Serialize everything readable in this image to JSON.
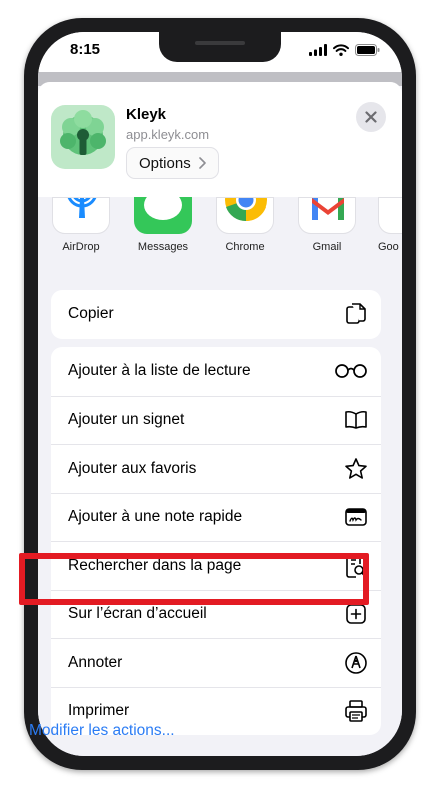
{
  "status_bar": {
    "time": "8:15"
  },
  "app": {
    "name": "Kleyk",
    "url": "app.kleyk.com",
    "options_label": "Options"
  },
  "share_targets": [
    {
      "label": "AirDrop",
      "icon": "airdrop-icon"
    },
    {
      "label": "Messages",
      "icon": "messages-icon"
    },
    {
      "label": "Chrome",
      "icon": "chrome-icon"
    },
    {
      "label": "Gmail",
      "icon": "gmail-icon"
    },
    {
      "label": "Goo",
      "icon": "google-icon"
    }
  ],
  "actions_group_1": [
    {
      "label": "Copier",
      "icon": "copy-icon"
    }
  ],
  "actions_group_2": [
    {
      "label": "Ajouter à la liste de lecture",
      "icon": "glasses-icon"
    },
    {
      "label": "Ajouter un signet",
      "icon": "book-icon"
    },
    {
      "label": "Ajouter aux favoris",
      "icon": "star-icon"
    },
    {
      "label": "Ajouter à une note rapide",
      "icon": "quick-note-icon"
    },
    {
      "label": "Rechercher dans la page",
      "icon": "find-in-page-icon"
    },
    {
      "label": "Sur l’écran d’accueil",
      "icon": "add-square-icon"
    },
    {
      "label": "Annoter",
      "icon": "markup-icon"
    },
    {
      "label": "Imprimer",
      "icon": "printer-icon"
    }
  ],
  "edit_actions_label": "Modifier les actions...",
  "colors": {
    "highlight": "#e31b23",
    "link": "#2b7cf4",
    "sheet_bg": "#f2f2f7"
  }
}
